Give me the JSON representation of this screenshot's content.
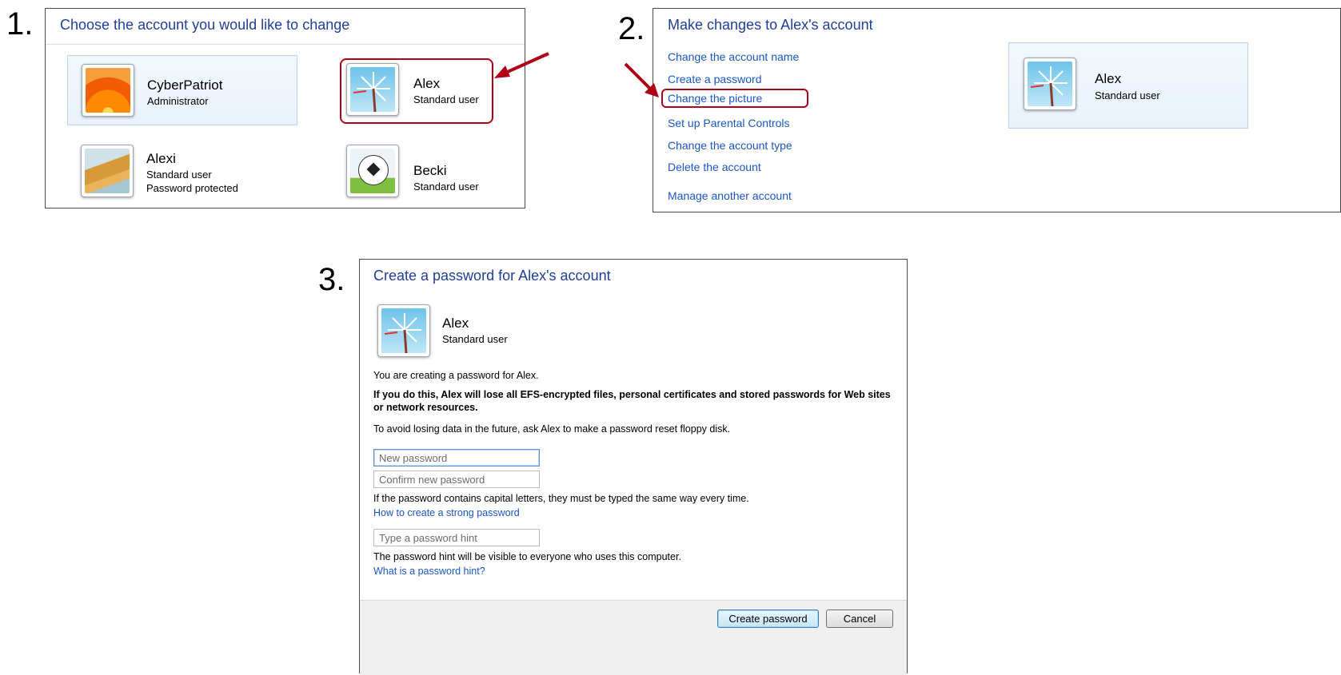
{
  "steps": [
    "1.",
    "2.",
    "3."
  ],
  "panel1": {
    "title": "Choose the account you would like to change",
    "accounts": [
      {
        "name": "CyberPatriot",
        "sub1": "Administrator",
        "sub2": "",
        "picture": "flower-icon"
      },
      {
        "name": "Alex",
        "sub1": "Standard user",
        "sub2": "",
        "picture": "windmill-icon"
      },
      {
        "name": "Alexi",
        "sub1": "Standard user",
        "sub2": "Password protected",
        "picture": "stairs-icon"
      },
      {
        "name": "Becki",
        "sub1": "Standard user",
        "sub2": "",
        "picture": "soccer-ball-icon"
      }
    ]
  },
  "panel2": {
    "title": "Make changes to Alex's account",
    "links": [
      "Change the account name",
      "Create a password",
      "Change the picture",
      "Set up Parental Controls",
      "Change the account type",
      "Delete the account"
    ],
    "manage_link": "Manage another account",
    "account": {
      "name": "Alex",
      "sub": "Standard user",
      "picture": "windmill-icon"
    }
  },
  "panel3": {
    "title": "Create a password for Alex's account",
    "account": {
      "name": "Alex",
      "sub": "Standard user",
      "picture": "windmill-icon"
    },
    "intro": "You are creating a password for Alex.",
    "warning": "If you do this, Alex will lose all EFS-encrypted files, personal certificates and stored passwords for Web sites or network resources.",
    "advice": "To avoid losing data in the future, ask Alex to make a password reset floppy disk.",
    "new_password_placeholder": "New password",
    "confirm_password_placeholder": "Confirm new password",
    "caps_note": "If the password contains capital letters, they must be typed the same way every time.",
    "strong_link": "How to create a strong password",
    "hint_placeholder": "Type a password hint",
    "hint_note": "The password hint will be visible to everyone who uses this computer.",
    "hint_link": "What is a password hint?",
    "create_button": "Create password",
    "cancel_button": "Cancel"
  },
  "colors": {
    "annotation": "#b00018",
    "link": "#1a56c4",
    "title": "#1f3f9a"
  }
}
